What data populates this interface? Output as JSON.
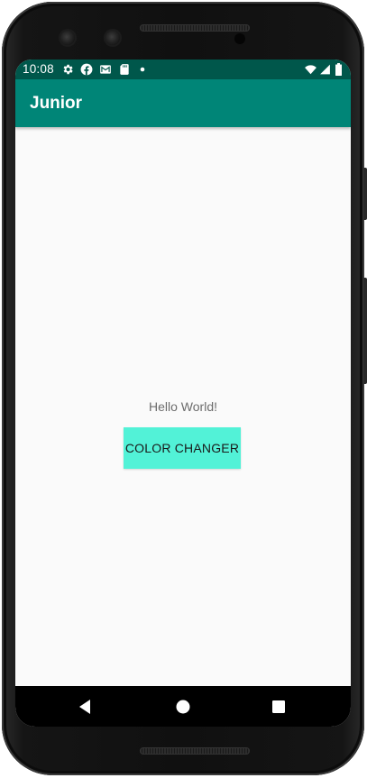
{
  "status_bar": {
    "time": "10:08",
    "left_icons": [
      "settings-icon",
      "facebook-icon",
      "gmail-icon",
      "sd-card-icon",
      "dot-icon"
    ],
    "right_icons": [
      "wifi-icon",
      "signal-icon",
      "battery-icon"
    ],
    "background_color": "#00574b"
  },
  "app_bar": {
    "title": "Junior",
    "background_color": "#008577"
  },
  "main": {
    "hello_text": "Hello World!",
    "button_label": "COLOR CHANGER",
    "button_color": "#52f2d7",
    "background_color": "#fafafa"
  },
  "nav_bar": {
    "buttons": [
      "back-icon",
      "home-icon",
      "recents-icon"
    ]
  }
}
